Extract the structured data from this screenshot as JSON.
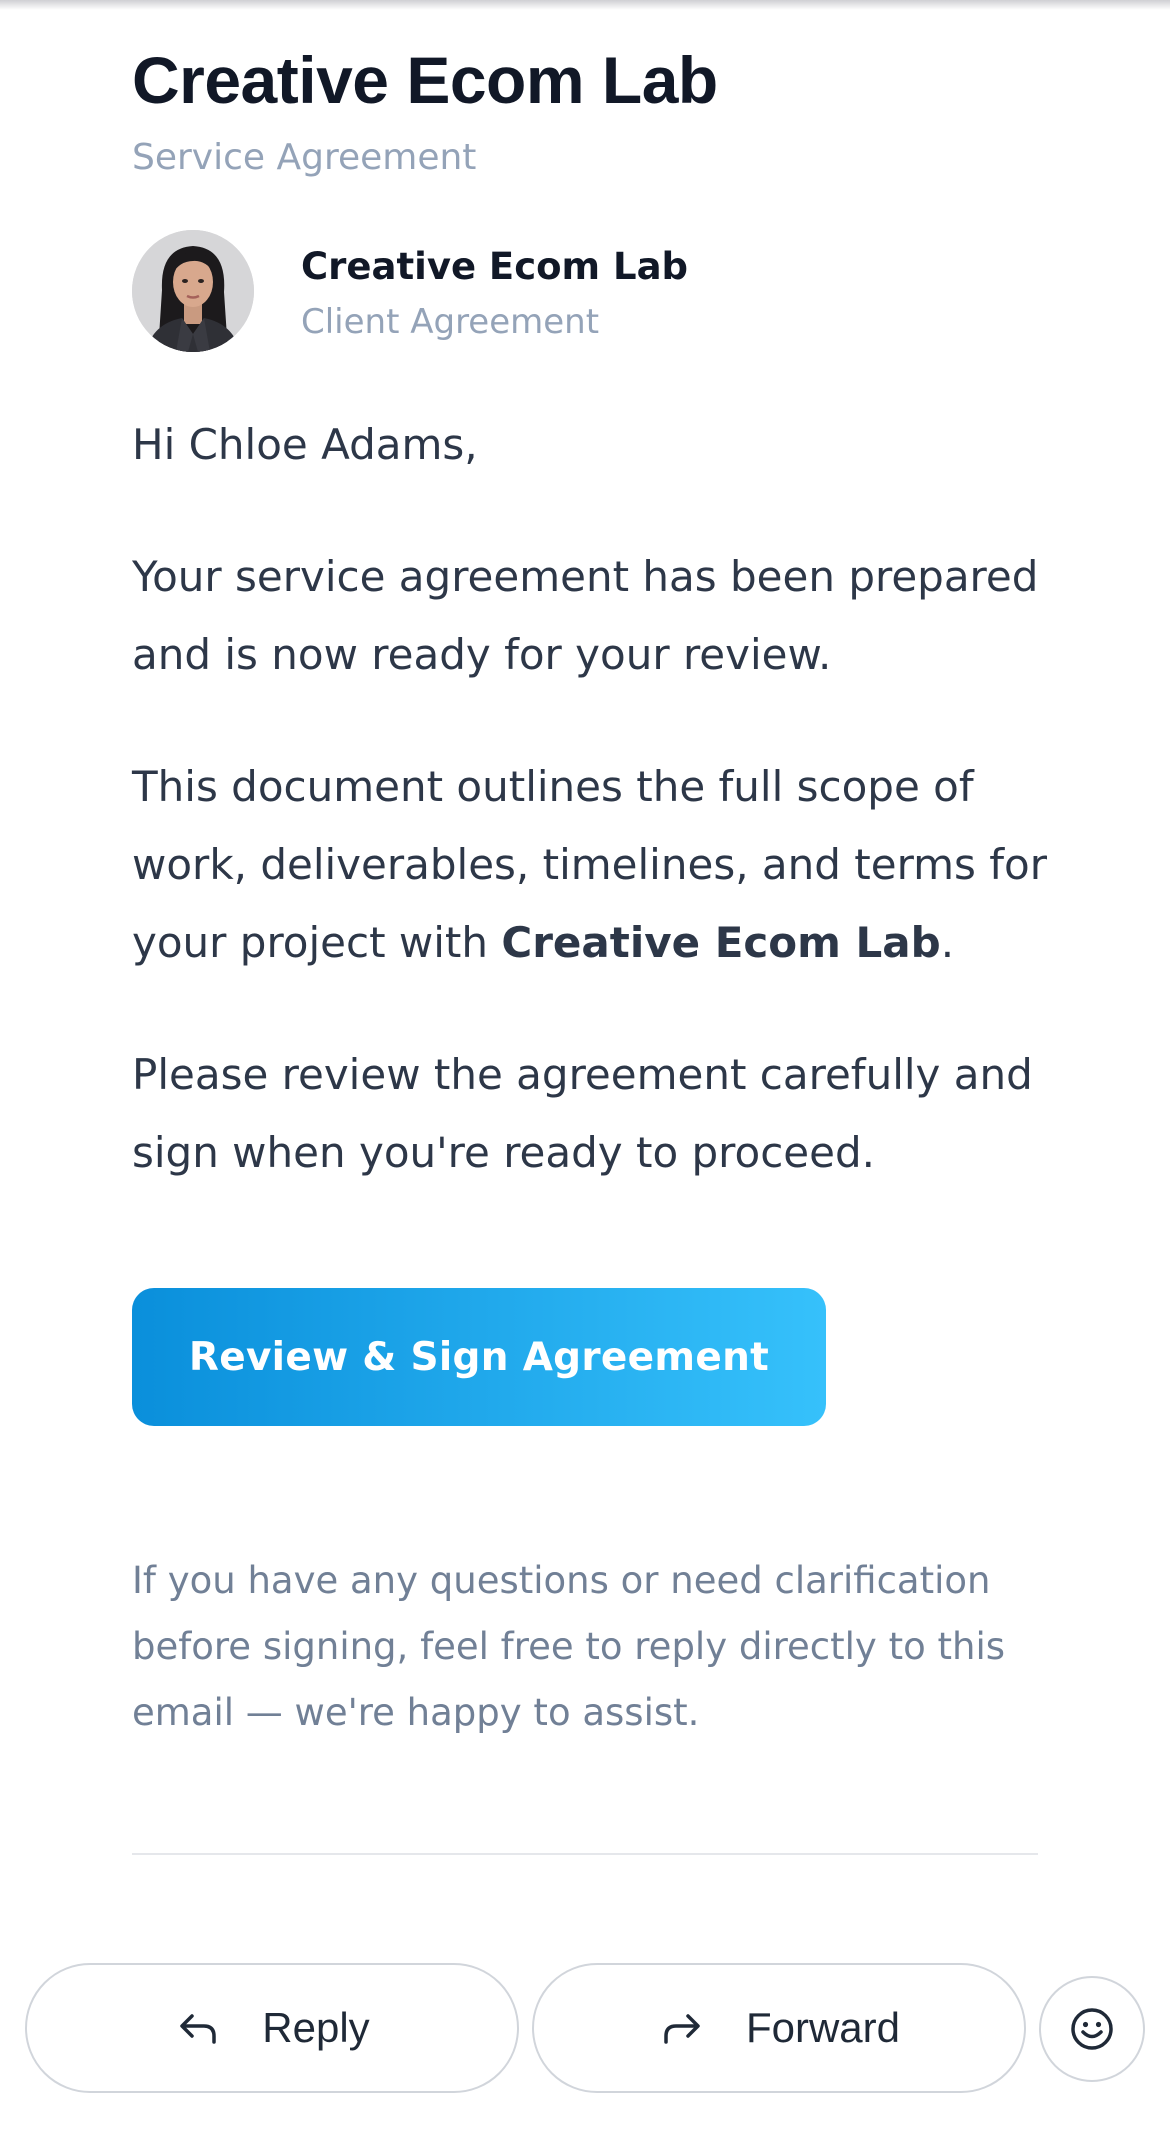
{
  "header": {
    "brand_title": "Creative Ecom Lab",
    "brand_subtitle": "Service Agreement"
  },
  "sender": {
    "name": "Creative Ecom Lab",
    "role": "Client Agreement",
    "avatar_icon": "person-photo-avatar"
  },
  "email": {
    "greeting": "Hi Chloe Adams,",
    "paragraph1": "Your service agreement has been prepared and is now ready for your review.",
    "paragraph2_before": "This document outlines the full scope of work, deliverables, timelines, and terms for your project with ",
    "paragraph2_bold": "Creative Ecom Lab",
    "paragraph2_after": ".",
    "paragraph3": "Please review the agreement carefully and sign when you're ready to proceed.",
    "cta_label": "Review & Sign Agreement",
    "note": "If you have any questions or need clarification before signing, feel free to reply directly to this email — we're happy to assist."
  },
  "actions": {
    "reply_label": "Reply",
    "forward_label": "Forward",
    "reply_icon": "reply-arrow-icon",
    "forward_icon": "forward-arrow-icon",
    "emoji_icon": "smiley-icon"
  },
  "colors": {
    "cta_start": "#0a8fdb",
    "cta_end": "#36c1fb",
    "title": "#111827",
    "muted": "#94a3b8",
    "body": "#2d3748"
  }
}
